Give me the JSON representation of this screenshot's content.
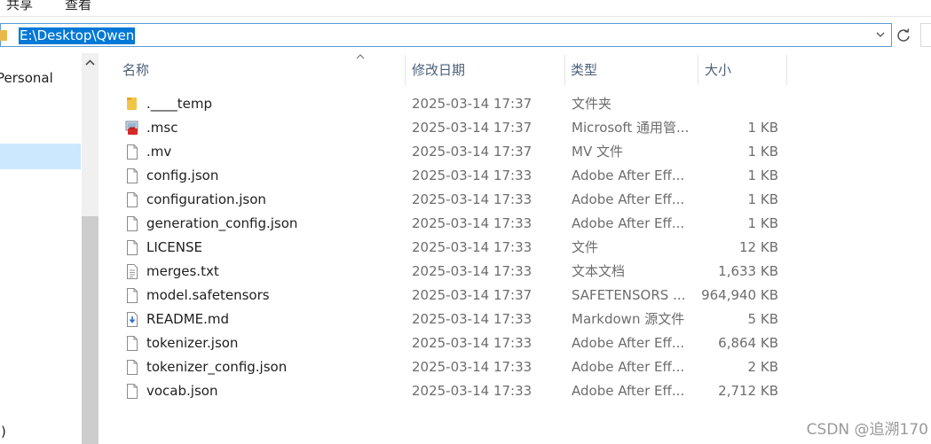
{
  "ribbon": {
    "tabs": [
      "共享",
      "查看"
    ]
  },
  "address": {
    "path": "E:\\Desktop\\Qwen"
  },
  "nav": {
    "items": [
      "Personal",
      ":)"
    ]
  },
  "columns": {
    "name": "名称",
    "date": "修改日期",
    "type": "类型",
    "size": "大小"
  },
  "files": [
    {
      "name": ".____temp",
      "date": "2025-03-14 17:37",
      "type": "文件夹",
      "size": "",
      "icon": "folder-icon"
    },
    {
      "name": ".msc",
      "date": "2025-03-14 17:37",
      "type": "Microsoft 通用管...",
      "size": "1 KB",
      "icon": "msc-file-icon"
    },
    {
      "name": ".mv",
      "date": "2025-03-14 17:37",
      "type": "MV 文件",
      "size": "1 KB",
      "icon": "file-icon"
    },
    {
      "name": "config.json",
      "date": "2025-03-14 17:33",
      "type": "Adobe After Eff...",
      "size": "1 KB",
      "icon": "file-icon"
    },
    {
      "name": "configuration.json",
      "date": "2025-03-14 17:33",
      "type": "Adobe After Eff...",
      "size": "1 KB",
      "icon": "file-icon"
    },
    {
      "name": "generation_config.json",
      "date": "2025-03-14 17:33",
      "type": "Adobe After Eff...",
      "size": "1 KB",
      "icon": "file-icon"
    },
    {
      "name": "LICENSE",
      "date": "2025-03-14 17:33",
      "type": "文件",
      "size": "12 KB",
      "icon": "file-icon"
    },
    {
      "name": "merges.txt",
      "date": "2025-03-14 17:33",
      "type": "文本文档",
      "size": "1,633 KB",
      "icon": "text-file-icon"
    },
    {
      "name": "model.safetensors",
      "date": "2025-03-14 17:37",
      "type": "SAFETENSORS ...",
      "size": "964,940 KB",
      "icon": "file-icon"
    },
    {
      "name": "README.md",
      "date": "2025-03-14 17:33",
      "type": "Markdown 源文件",
      "size": "5 KB",
      "icon": "markdown-file-icon"
    },
    {
      "name": "tokenizer.json",
      "date": "2025-03-14 17:33",
      "type": "Adobe After Eff...",
      "size": "6,864 KB",
      "icon": "file-icon"
    },
    {
      "name": "tokenizer_config.json",
      "date": "2025-03-14 17:33",
      "type": "Adobe After Eff...",
      "size": "2 KB",
      "icon": "file-icon"
    },
    {
      "name": "vocab.json",
      "date": "2025-03-14 17:33",
      "type": "Adobe After Eff...",
      "size": "2,712 KB",
      "icon": "file-icon"
    }
  ],
  "watermark": "CSDN @追溯170",
  "colors": {
    "selection": "#0078d7",
    "nav_selected": "#cce8ff",
    "header_text": "#4c607a"
  }
}
